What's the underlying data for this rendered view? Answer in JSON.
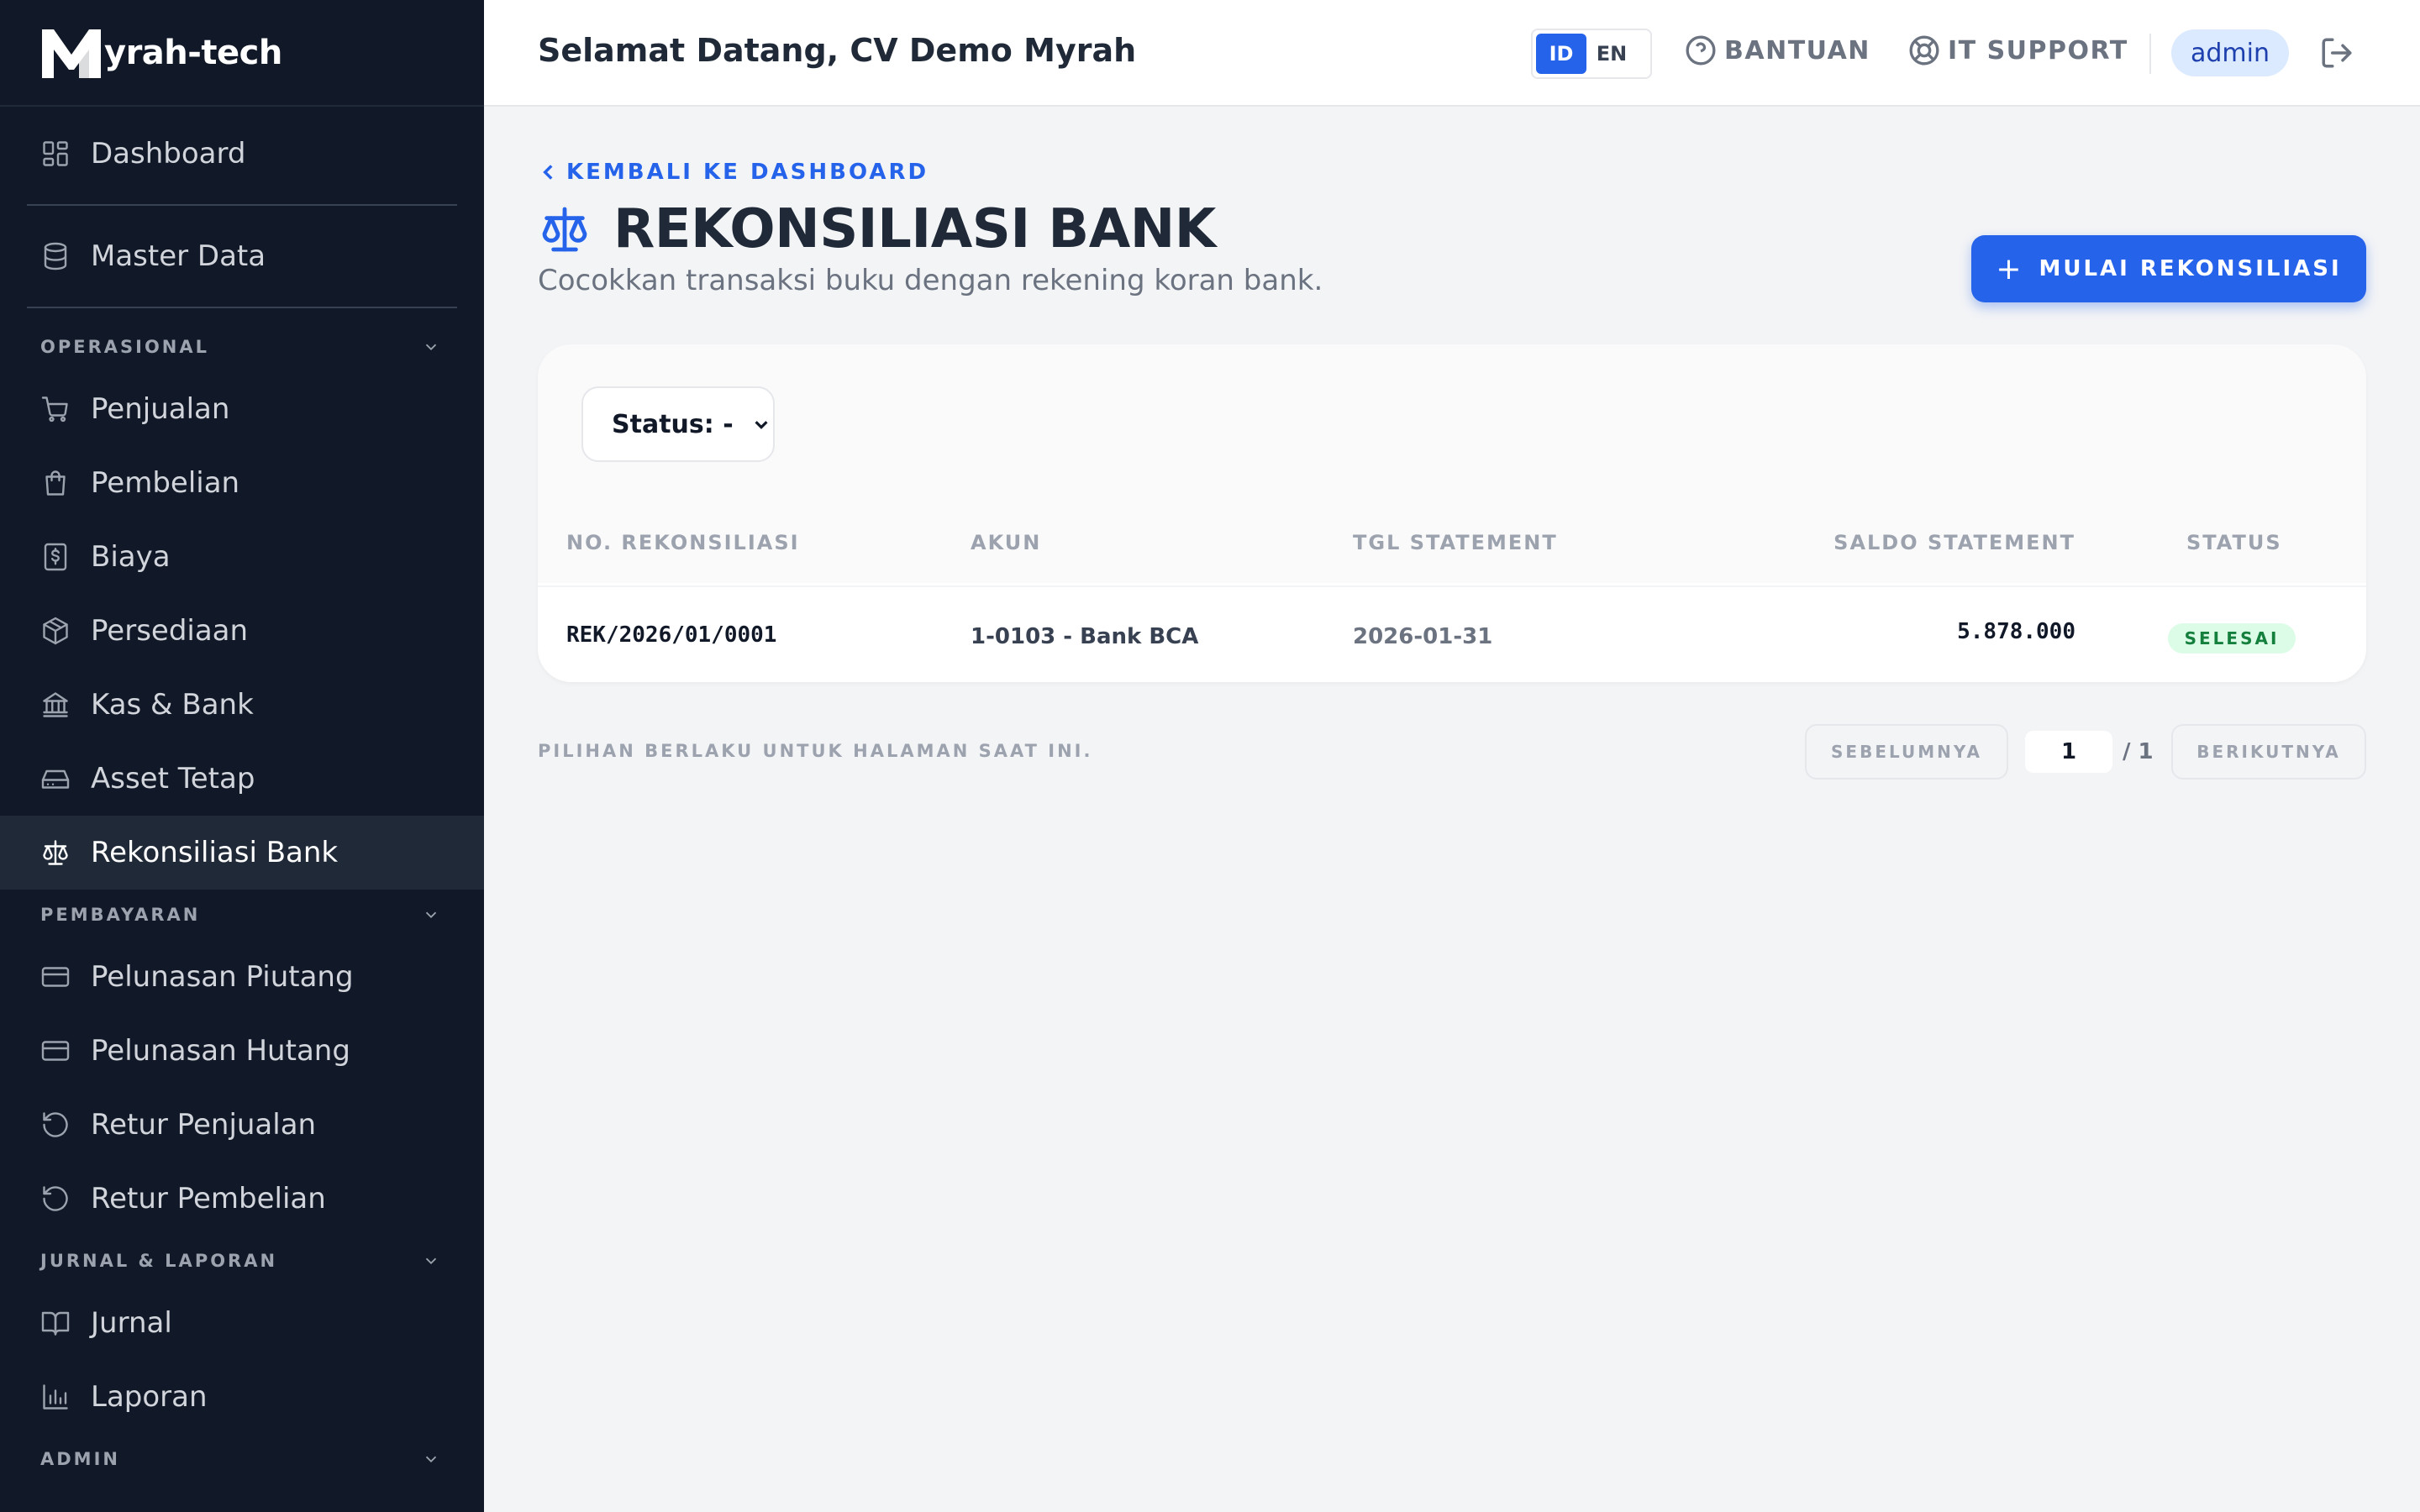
{
  "app": {
    "brand_name": "yrah-tech",
    "colors": {
      "sidebar_bg": "#111827",
      "accent": "#2563eb",
      "success": "#15803d"
    }
  },
  "sidebar": {
    "top_items": [
      {
        "label": "Dashboard",
        "icon": "grid-icon"
      },
      {
        "label": "Master Data",
        "icon": "database-icon"
      }
    ],
    "sections": {
      "operasional": "OPERASIONAL",
      "pembayaran": "PEMBAYARAN",
      "jurnal_laporan": "JURNAL & LAPORAN",
      "admin": "ADMIN"
    },
    "operasional_items": [
      {
        "label": "Penjualan",
        "icon": "cart-icon"
      },
      {
        "label": "Pembelian",
        "icon": "bag-icon"
      },
      {
        "label": "Biaya",
        "icon": "receipt-icon"
      },
      {
        "label": "Persediaan",
        "icon": "box-icon"
      },
      {
        "label": "Kas & Bank",
        "icon": "bank-icon"
      },
      {
        "label": "Asset Tetap",
        "icon": "drive-icon"
      },
      {
        "label": "Rekonsiliasi Bank",
        "icon": "scale-icon",
        "active": true
      }
    ],
    "pembayaran_items": [
      {
        "label": "Pelunasan Piutang",
        "icon": "card-icon"
      },
      {
        "label": "Pelunasan Hutang",
        "icon": "card-icon"
      },
      {
        "label": "Retur Penjualan",
        "icon": "undo-icon"
      },
      {
        "label": "Retur Pembelian",
        "icon": "undo-icon"
      }
    ],
    "jurnal_items": [
      {
        "label": "Jurnal",
        "icon": "book-icon"
      },
      {
        "label": "Laporan",
        "icon": "chart-icon"
      }
    ]
  },
  "header": {
    "welcome": "Selamat Datang, CV Demo Myrah",
    "lang_id": "ID",
    "lang_en": "EN",
    "help_label": "BANTUAN",
    "support_label": "IT SUPPORT",
    "user": "admin"
  },
  "page": {
    "back_label": "KEMBALI KE DASHBOARD",
    "title": "REKONSILIASI BANK",
    "subtitle": "Cocokkan transaksi buku dengan rekening koran bank.",
    "primary_action": "MULAI REKONSILIASI",
    "filter": {
      "selected": "Status: -"
    }
  },
  "table": {
    "columns": [
      "NO. REKONSILIASI",
      "AKUN",
      "TGL STATEMENT",
      "SALDO STATEMENT",
      "STATUS"
    ],
    "rows": [
      {
        "number": "REK/2026/01/0001",
        "account": "1-0103 - Bank BCA",
        "date": "2026-01-31",
        "balance": "5.878.000",
        "status": "SELESAI"
      }
    ]
  },
  "pagination": {
    "note": "PILIHAN BERLAKU UNTUK HALAMAN SAAT INI.",
    "prev": "SEBELUMNYA",
    "current": "1",
    "total": "/ 1",
    "next": "BERIKUTNYA"
  }
}
